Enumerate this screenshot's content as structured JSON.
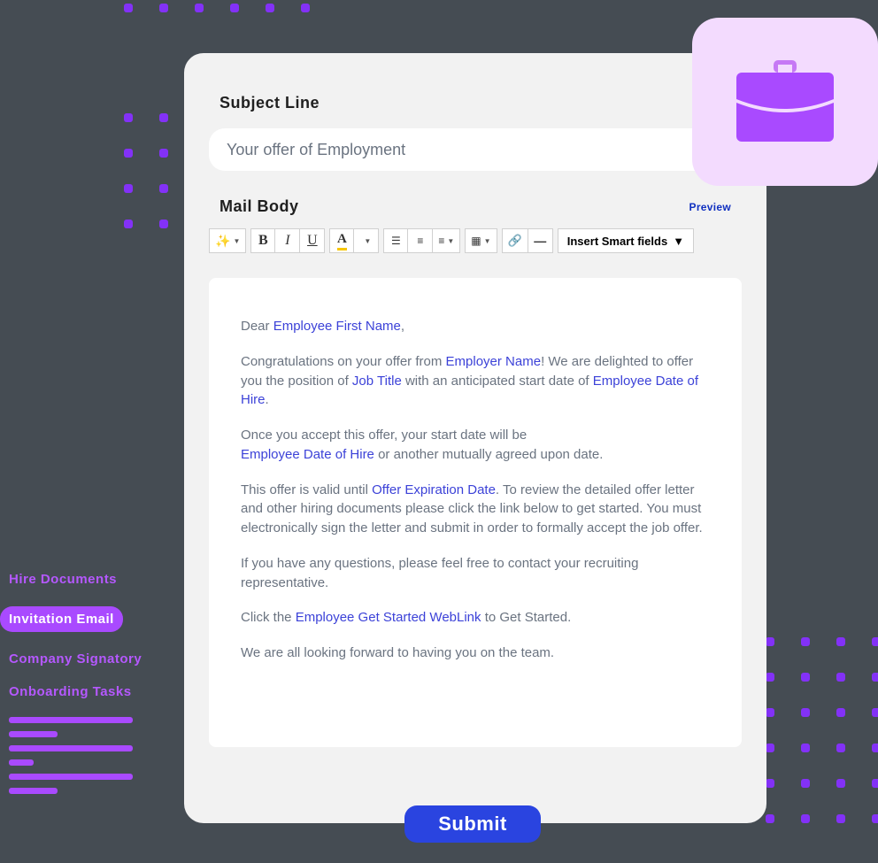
{
  "sidebar": {
    "items": [
      {
        "label": "Hire Documents",
        "active": false
      },
      {
        "label": "Invitation Email",
        "active": true
      },
      {
        "label": "Company Signatory",
        "active": false
      },
      {
        "label": "Onboarding Tasks",
        "active": false
      }
    ]
  },
  "form": {
    "subject_label": "Subject Line",
    "subject_value": "Your offer of Employment",
    "mail_body_label": "Mail Body",
    "preview_label": "Preview"
  },
  "toolbar": {
    "bold": "B",
    "italic": "I",
    "underline": "U",
    "fontcolor": "A",
    "smart_fields": "Insert Smart fields"
  },
  "mail": {
    "greeting_pre": "Dear ",
    "greeting_field": "Employee First Name",
    "greeting_post": ",",
    "p1_a": "Congratulations on your offer from ",
    "p1_field1": "Employer Name",
    "p1_b": "! We are delighted to offer you the position of ",
    "p1_field2": "Job Title",
    "p1_c": " with an anticipated start date of ",
    "p1_field3": "Employee Date of Hire",
    "p1_d": ".",
    "p2_a": "Once you accept this offer, your start date will be ",
    "p2_field1": "Employee Date of Hire",
    "p2_b": " or another mutually agreed upon date.",
    "p3_a": "This offer is valid until ",
    "p3_field1": "Offer Expiration Date",
    "p3_b": ". To review the detailed offer letter and other hiring documents please click the link below to get started. You must electronically sign the letter and submit in order to formally accept the job offer.",
    "p4": "If you have any questions, please feel free to contact your recruiting representative.",
    "p5_a": "Click the ",
    "p5_field1": "Employee Get Started WebLink",
    "p5_b": " to Get Started.",
    "p6": "We are all looking forward to having you on the team."
  },
  "submit_label": "Submit"
}
